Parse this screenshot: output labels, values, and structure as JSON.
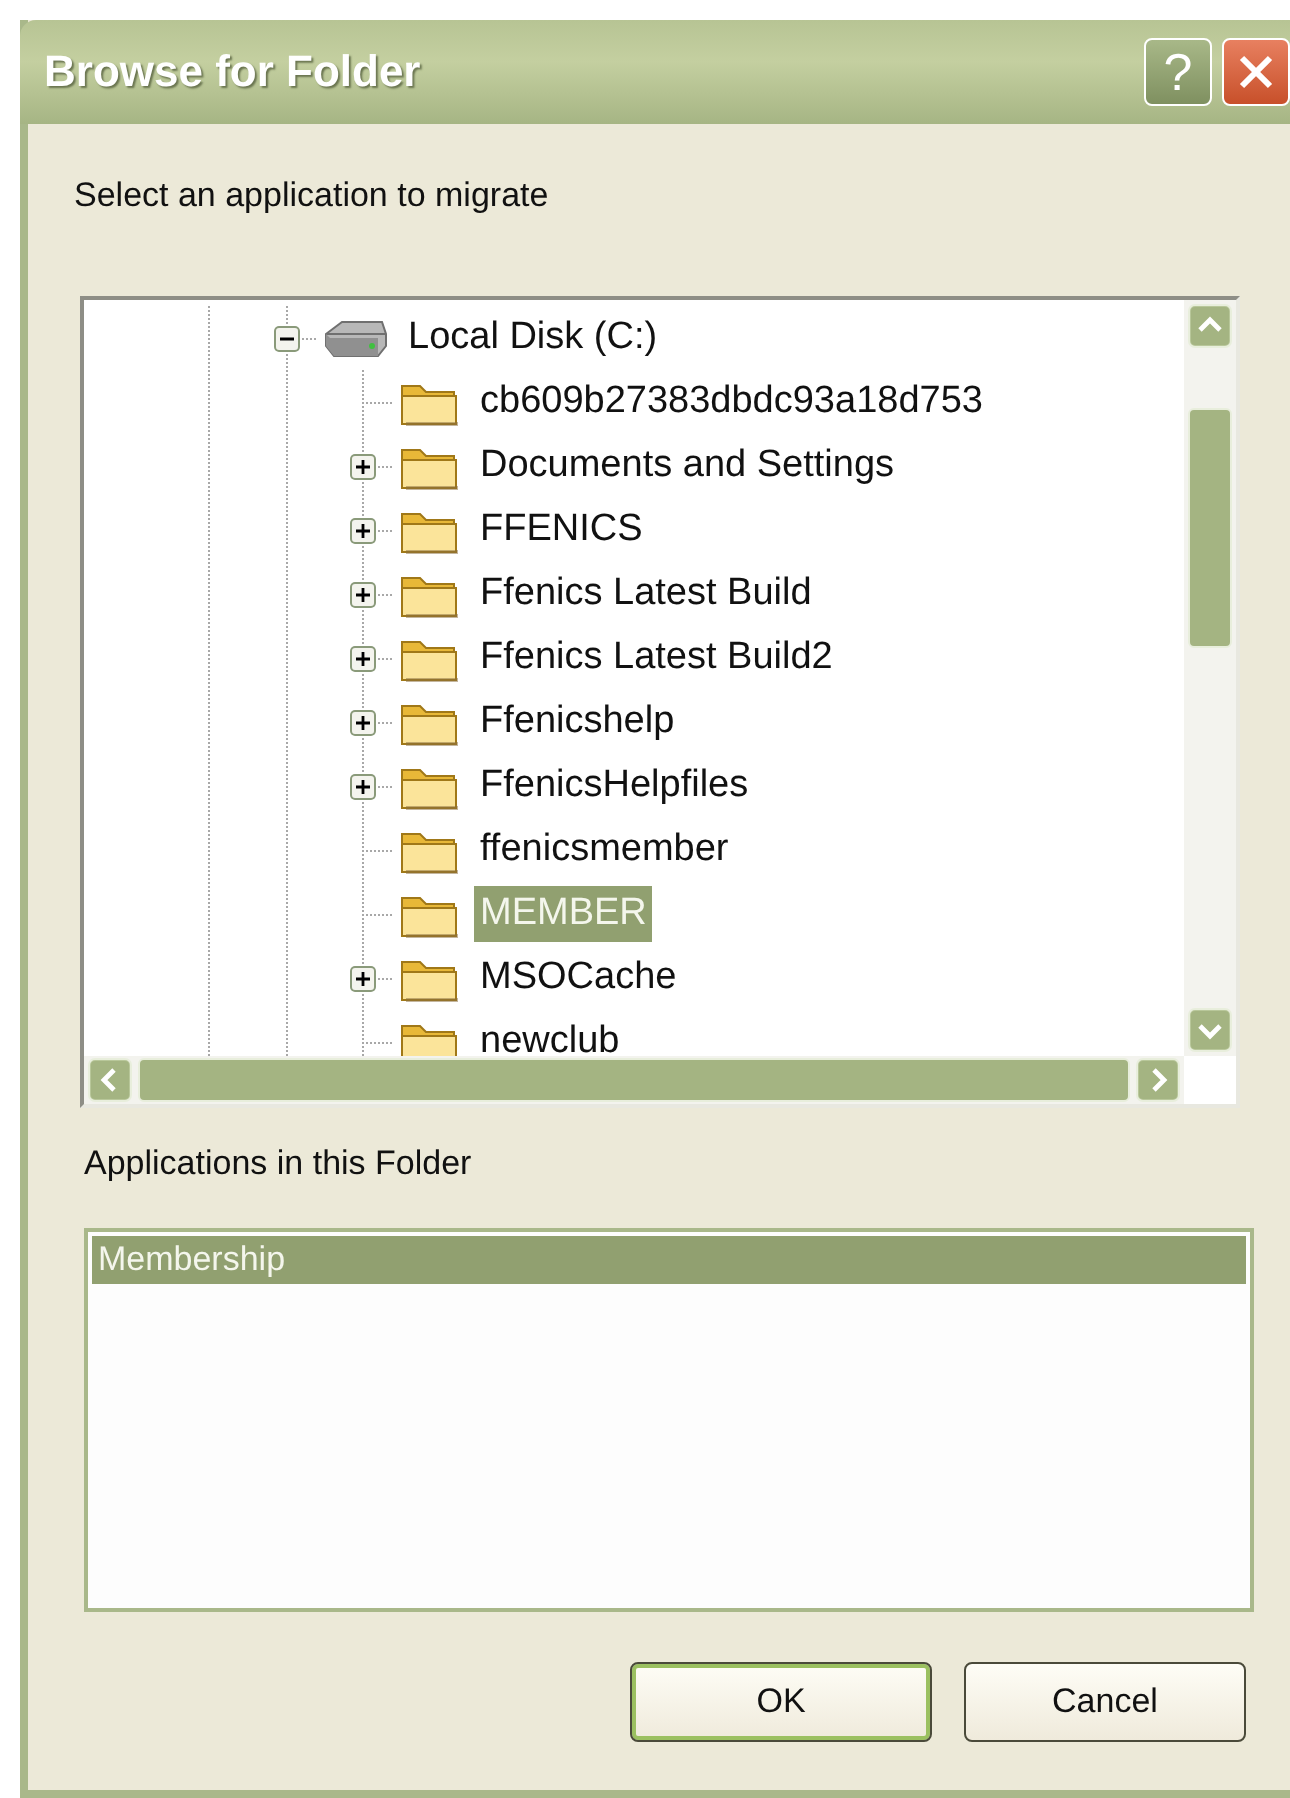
{
  "window": {
    "title": "Browse for Folder",
    "help_button": "?"
  },
  "prompt": "Select an application to migrate",
  "tree": {
    "label": "Local Disk (C:)",
    "kind": "drive",
    "expanded": true,
    "selected": false,
    "children": [
      {
        "label": "cb609b27383dbdc93a18d753",
        "kind": "folder",
        "selected": false
      },
      {
        "label": "Documents and Settings",
        "kind": "folder",
        "expanded": false,
        "selected": false
      },
      {
        "label": "FFENICS",
        "kind": "folder",
        "expanded": false,
        "selected": false
      },
      {
        "label": "Ffenics Latest Build",
        "kind": "folder",
        "expanded": false,
        "selected": false
      },
      {
        "label": "Ffenics Latest Build2",
        "kind": "folder",
        "expanded": false,
        "selected": false
      },
      {
        "label": "Ffenicshelp",
        "kind": "folder",
        "expanded": false,
        "selected": false
      },
      {
        "label": "FfenicsHelpfiles",
        "kind": "folder",
        "expanded": false,
        "selected": false
      },
      {
        "label": "ffenicsmember",
        "kind": "folder",
        "selected": false
      },
      {
        "label": "MEMBER",
        "kind": "folder",
        "selected": true
      },
      {
        "label": "MSOCache",
        "kind": "folder",
        "expanded": false,
        "selected": false
      },
      {
        "label": "newclub",
        "kind": "folder",
        "selected": false
      }
    ]
  },
  "applications_label": "Applications in this Folder",
  "applications": [
    {
      "label": "Membership",
      "selected": true
    }
  ],
  "buttons": [
    {
      "label": "OK",
      "default": true
    },
    {
      "label": "Cancel",
      "default": false
    }
  ]
}
